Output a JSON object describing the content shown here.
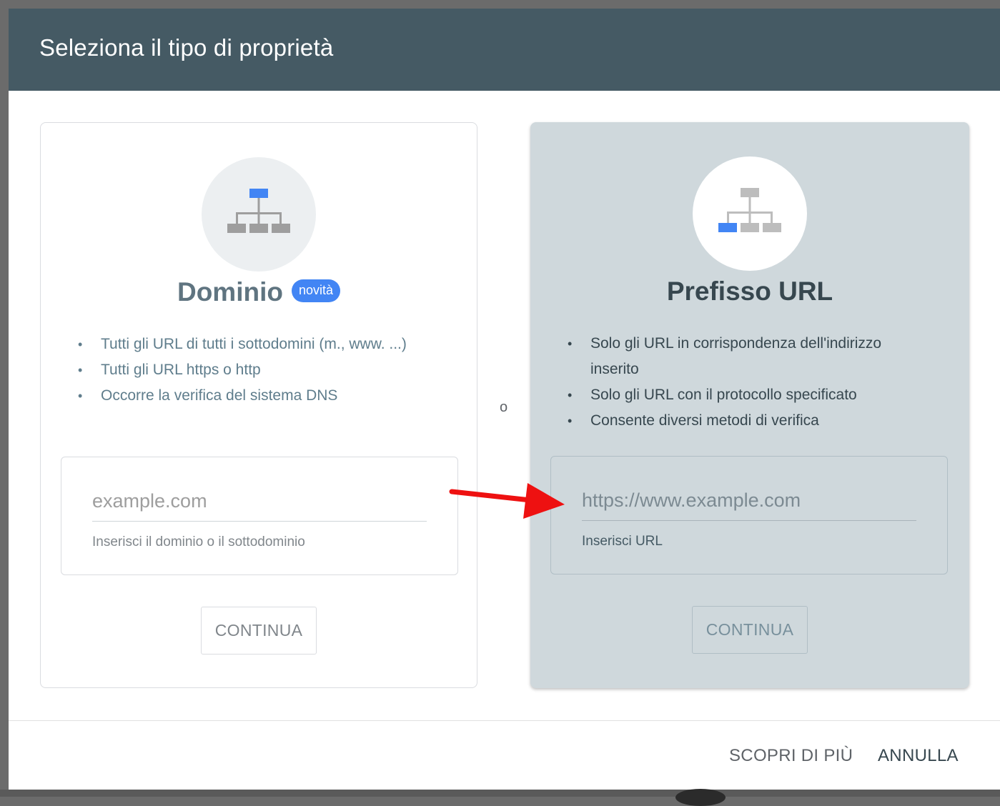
{
  "dialog": {
    "title": "Seleziona il tipo di proprietà"
  },
  "domain_card": {
    "icon": "sitemap-icon-top-highlighted",
    "title": "Dominio",
    "badge": "novità",
    "features": [
      "Tutti gli URL di tutti i sottodomini (m., www. ...)",
      "Tutti gli URL https o http",
      "Occorre la verifica del sistema DNS"
    ],
    "input_placeholder": "example.com",
    "input_value": "",
    "input_hint": "Inserisci il dominio o il sottodominio",
    "continue_label": "CONTINUA"
  },
  "separator": "o",
  "url_card": {
    "icon": "sitemap-icon-leaf-highlighted",
    "title": "Prefisso URL",
    "features": [
      "Solo gli URL in corrispondenza dell'indirizzo inserito",
      "Solo gli URL con il protocollo specificato",
      "Consente diversi metodi di verifica"
    ],
    "input_placeholder": "https://www.example.com",
    "input_value": "",
    "input_hint": "Inserisci URL",
    "continue_label": "CONTINUA"
  },
  "footer": {
    "learn_more_label": "SCOPRI DI PIÙ",
    "cancel_label": "ANNULLA"
  },
  "colors": {
    "header_bg": "#455a64",
    "accent_blue": "#4285f4",
    "selected_card_bg": "#cfd8dc",
    "annotation_arrow": "#ee1111"
  }
}
